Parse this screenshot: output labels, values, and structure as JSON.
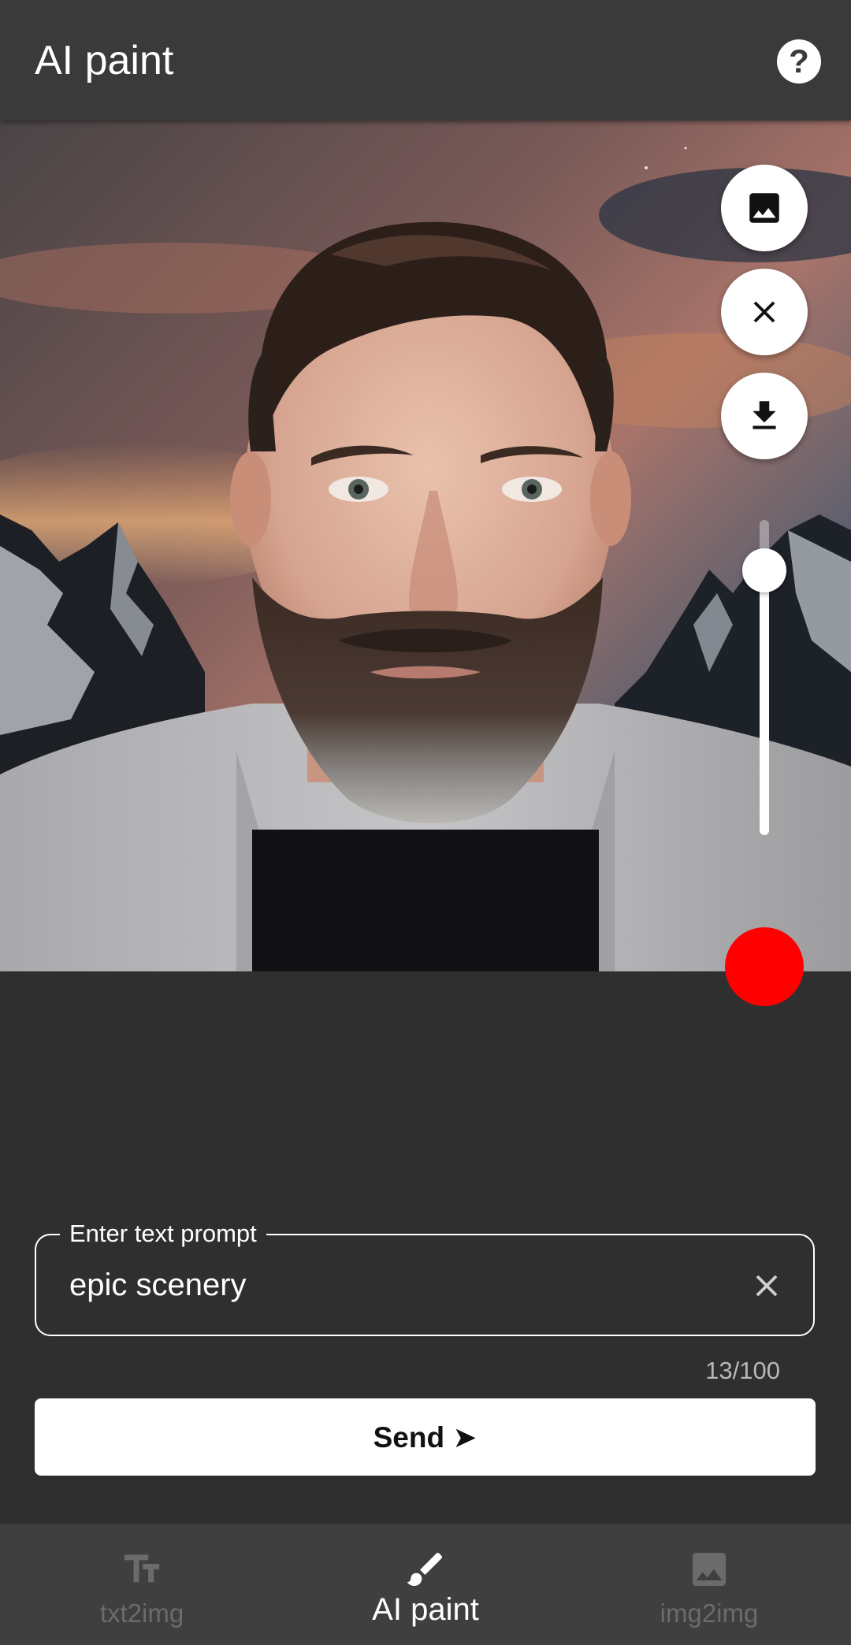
{
  "header": {
    "title": "AI paint",
    "help_icon": "help-circle-icon",
    "help_glyph": "?"
  },
  "canvas": {
    "content": "photo-portrait",
    "actions": [
      {
        "name": "pick-image",
        "icon": "image-icon"
      },
      {
        "name": "clear",
        "icon": "close-icon"
      },
      {
        "name": "download",
        "icon": "download-icon"
      }
    ],
    "brush_size_fraction": 0.84,
    "brush_color": "#ff0000"
  },
  "prompt": {
    "label": "Enter text prompt",
    "value": "epic scenery",
    "counter": "13/100",
    "clear_icon": "close-icon"
  },
  "send": {
    "label": "Send ➤"
  },
  "bottom_nav": {
    "items": [
      {
        "label": "txt2img",
        "icon": "text-fields-icon",
        "active": false
      },
      {
        "label": "AI paint",
        "icon": "brush-icon",
        "active": true
      },
      {
        "label": "img2img",
        "icon": "image-icon",
        "active": false
      }
    ]
  },
  "colors": {
    "background": "#2f2f2f",
    "header": "#3a3a3a",
    "nav": "#3f3f3f",
    "accent": "#ffffff",
    "inactive_nav": "#6b6b6b"
  }
}
